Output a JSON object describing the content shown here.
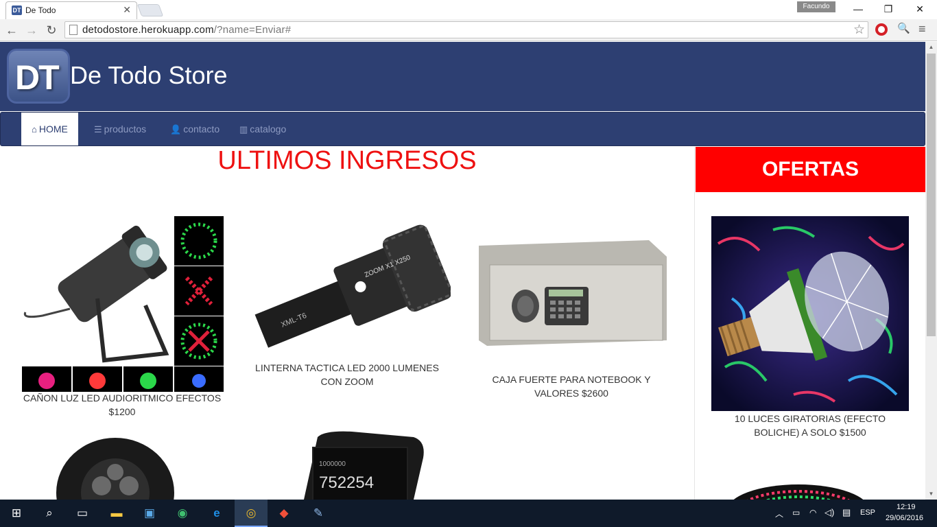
{
  "browser": {
    "tab_title": "De Todo",
    "tab_favicon": "DT",
    "profile_name": "Facundo",
    "url_host": "detodostore.herokuapp.com",
    "url_rest": "/?name=Enviar#"
  },
  "site": {
    "logo": "DT",
    "title": "De Todo Store"
  },
  "nav": [
    {
      "label": "HOME",
      "icon": "home-icon",
      "active": true
    },
    {
      "label": "productos",
      "icon": "list-icon",
      "active": false
    },
    {
      "label": "contacto",
      "icon": "user-icon",
      "active": false
    },
    {
      "label": "catalogo",
      "icon": "barcode-icon",
      "active": false
    }
  ],
  "ultimos": {
    "title": "ULTIMOS INGRESOS",
    "products": [
      {
        "caption": "CAÑON LUZ LED AUDIORITMICO EFECTOS $1200"
      },
      {
        "caption": "LINTERNA TACTICA LED 2000 LUMENES CON ZOOM"
      },
      {
        "caption": "CAJA FUERTE PARA NOTEBOOK Y VALORES $2600"
      }
    ]
  },
  "ofertas": {
    "title": "OFERTAS",
    "items": [
      {
        "caption": "10 LUCES GIRATORIAS (EFECTO BOLICHE) A SOLO $1500"
      }
    ]
  },
  "taskbar": {
    "language": "ESP",
    "time": "12:19",
    "date": "29/06/2016"
  },
  "colors": {
    "brand": "#2d3f72",
    "accent_red": "#ff0000"
  }
}
